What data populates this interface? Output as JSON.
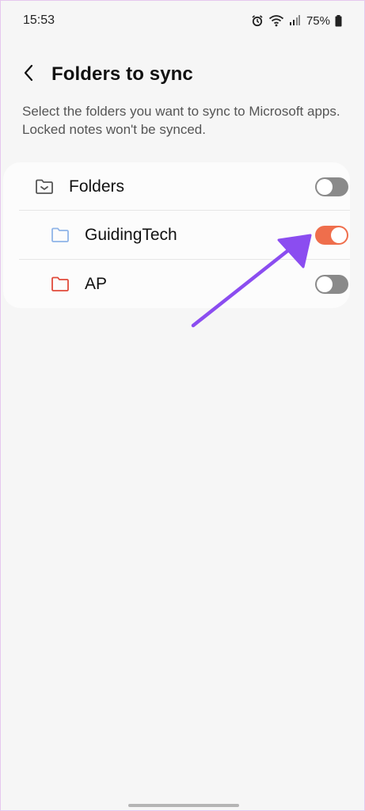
{
  "status_bar": {
    "time": "15:53",
    "battery": "75%",
    "icons": [
      "alarm-icon",
      "wifi-icon",
      "signal-icon",
      "battery-icon"
    ]
  },
  "header": {
    "back_icon": "chevron-left-icon",
    "title": "Folders to sync"
  },
  "description": "Select the folders you want to sync to Microsoft apps. Locked notes won't be synced.",
  "folders": [
    {
      "label": "Folders",
      "icon": "folder-outline-icon",
      "icon_color": "#555555",
      "enabled": false
    },
    {
      "label": "GuidingTech",
      "icon": "folder-icon",
      "icon_color": "#8fb4e8",
      "enabled": true
    },
    {
      "label": "AP",
      "icon": "folder-icon",
      "icon_color": "#e04a3a",
      "enabled": false
    }
  ],
  "colors": {
    "toggle_on": "#ef6e4c",
    "toggle_off": "#8a8a8a",
    "annotation_arrow": "#8b4df0"
  }
}
